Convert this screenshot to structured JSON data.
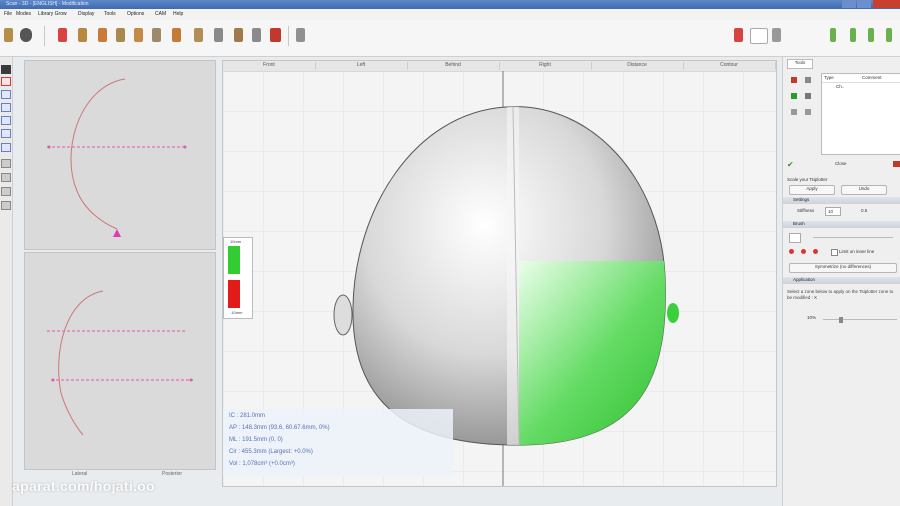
{
  "window": {
    "title": "Scan - 3D - [ENGLISH] - Modification"
  },
  "menu": [
    "File",
    "Modes",
    "Library Grow",
    "Display",
    "Tools",
    "Options",
    "CAM",
    "Help"
  ],
  "viewport": {
    "tabs": [
      "Front",
      "Left",
      "Behind",
      "Right",
      "Distance",
      "Contour"
    ],
    "legend": {
      "top": "10mm",
      "bottom": "-10mm"
    },
    "measurements": [
      "IC : 281.0mm",
      "AP : 148.3mm (93.6, 60.67.6mm, 0%)",
      "ML : 191.5mm (0, 0)",
      "Cir : 455.3mm (Largest: +0.0%)",
      "Vol : 1,078cm³ (+0.0cm³)"
    ]
  },
  "sideviews": {
    "bottom_tabs": [
      "Lateral",
      "Posterior"
    ]
  },
  "right_panel": {
    "tab": "Tools",
    "table_headers": [
      "Type",
      "Comment"
    ],
    "table_row": "Ch..",
    "close_label": "Close",
    "section_label": "Scale your Tsiplotter",
    "btn_apply": "Apply",
    "btn_undo": "Undo",
    "sections": [
      "Settings",
      "Brush",
      "Application"
    ],
    "stiffness_label": "Stiffness",
    "stiffness_value": "10",
    "stiffness_extra": "0.5",
    "brush_opt": "Limit on inner line",
    "show_diff_btn": "Symmetrize (no differences)",
    "help_text": "Select a zone below to apply on the Tsiplotter zone to be modified : X",
    "slider_label": "10%"
  },
  "watermark": "aparat.com/hojati.oo",
  "colors": {
    "green": "#33cc33",
    "red": "#e21a1a",
    "accent": "#3e6bb0"
  }
}
